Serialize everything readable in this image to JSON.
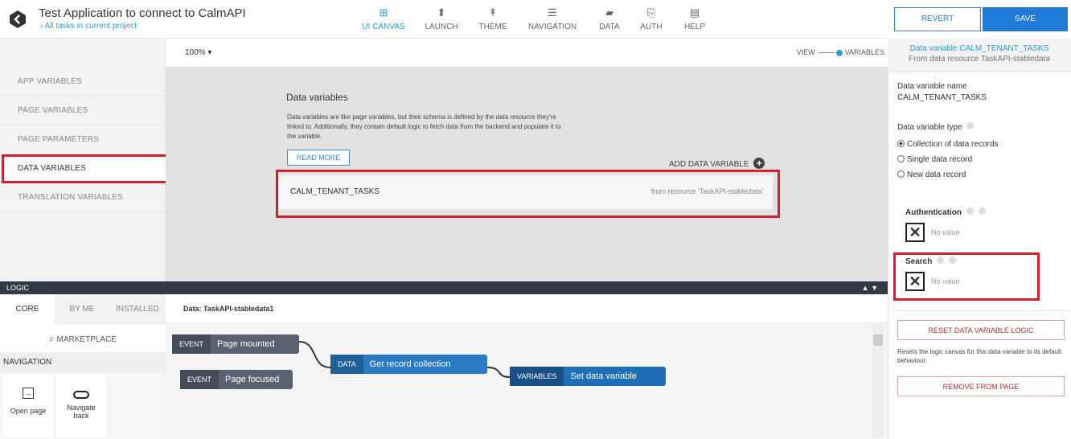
{
  "app": {
    "title": "Test Application to connect to CalmAPI",
    "breadcrumb": "All tasks in current project"
  },
  "nav": [
    {
      "label": "UI CANVAS",
      "icon": "ui-canvas-icon",
      "glyph": "⊞",
      "active": true
    },
    {
      "label": "LAUNCH",
      "icon": "launch-icon",
      "glyph": "⬆"
    },
    {
      "label": "THEME",
      "icon": "theme-icon",
      "glyph": "↟"
    },
    {
      "label": "NAVIGATION",
      "icon": "navigation-icon",
      "glyph": "☰"
    },
    {
      "label": "DATA",
      "icon": "data-folder-icon",
      "glyph": "▰"
    },
    {
      "label": "AUTH",
      "icon": "auth-icon",
      "glyph": "⎘"
    },
    {
      "label": "HELP",
      "icon": "help-icon",
      "glyph": "▤"
    }
  ],
  "actions": {
    "revert": "REVERT",
    "save": "SAVE"
  },
  "left_menu": [
    "APP VARIABLES",
    "PAGE VARIABLES",
    "PAGE PARAMETERS",
    "DATA VARIABLES",
    "TRANSLATION VARIABLES"
  ],
  "toolbar": {
    "zoom": "100%",
    "view": "VIEW",
    "variables": "VARIABLES"
  },
  "canvas": {
    "heading": "Data variables",
    "description": "Data variables are like page variables, but their schema is defined by the data resource they're linked to. Additionally, they contain default logic to fetch data from the backend and populate it to the variable.",
    "read_more": "READ MORE",
    "add_label": "ADD DATA VARIABLE",
    "variable_name": "CALM_TENANT_TASKS",
    "variable_source": "from resource 'TaskAPI-stabledata'"
  },
  "right_panel": {
    "header_title": "Data variable CALM_TENANT_TASKS",
    "header_sub": "From data resource TaskAPI-stabledata",
    "name_label": "Data variable name",
    "name_value": "CALM_TENANT_TASKS",
    "type_label": "Data variable type",
    "type_options": [
      "Collection of data records",
      "Single data record",
      "New data record"
    ],
    "selected_type": 0,
    "auth_label": "Authentication",
    "search_label": "Search",
    "no_value": "No value",
    "reset_button": "RESET DATA VARIABLE LOGIC",
    "reset_desc": "Resets the logic canvas for this data variable to its default behaviour.",
    "remove_button": "REMOVE FROM PAGE"
  },
  "logic": {
    "bar_label": "LOGIC",
    "tabs": [
      "CORE",
      "BY ME",
      "INSTALLED"
    ],
    "marketplace": "MARKETPLACE",
    "nav_header": "NAVIGATION",
    "nav_items": [
      "Open page",
      "Navigate back"
    ],
    "data_header": "Data: TaskAPI-stabledata1",
    "blocks": [
      {
        "tag": "EVENT",
        "label": "Page mounted"
      },
      {
        "tag": "EVENT",
        "label": "Page focused"
      },
      {
        "tag": "DATA",
        "label": "Get record collection"
      },
      {
        "tag": "VARIABLES",
        "label": "Set data variable"
      }
    ]
  },
  "colors": {
    "accent": "#2a9fd8",
    "save": "#1e7bd8",
    "highlight": "#d32030",
    "event": "#5a6170",
    "data": "#2a7bc4",
    "variables": "#1f6fb8"
  }
}
